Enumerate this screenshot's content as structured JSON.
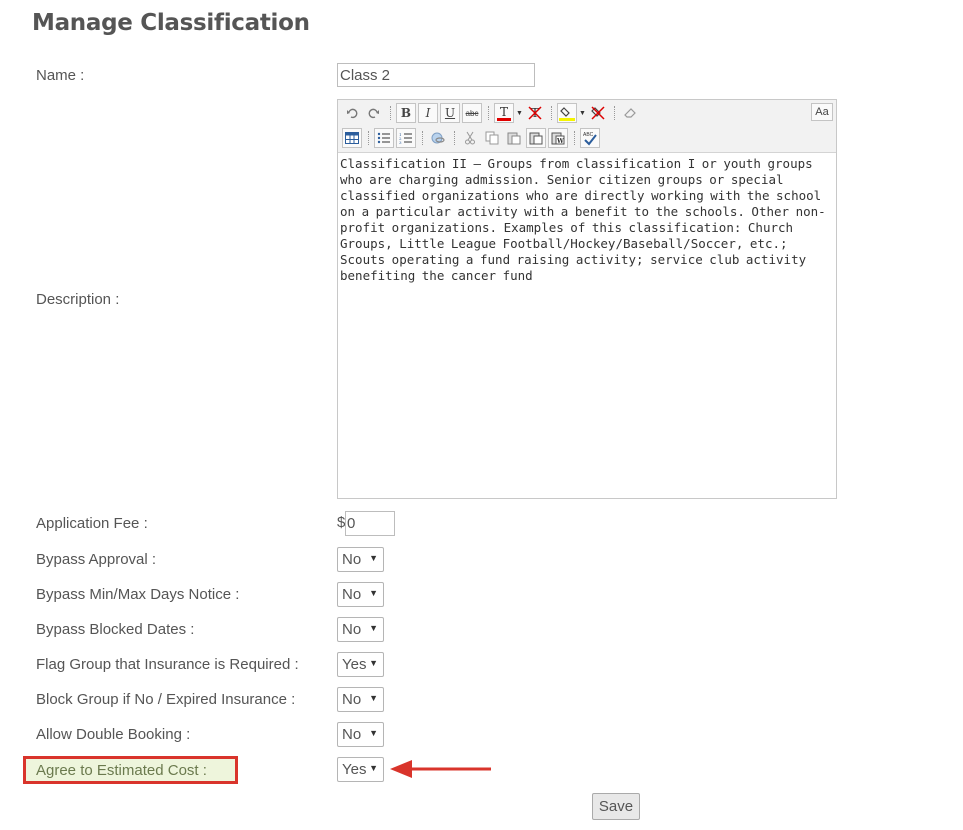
{
  "page": {
    "title": "Manage Classification"
  },
  "name_field": {
    "label": "Name :",
    "value": "Class 2"
  },
  "description": {
    "label": "Description :",
    "text": "Classification II – Groups from classification I or youth groups who are charging admission. Senior citizen groups or special classified organizations who are directly working with the school on a particular activity with a benefit to the schools. Other non-profit organizations. Examples of this classification: Church Groups, Little League Football/Hockey/Baseball/Soccer, etc.; Scouts operating a fund raising activity; service club activity benefiting the cancer fund",
    "toolbar": {
      "font_size_label": "Aa",
      "icons": [
        "undo-icon",
        "redo-icon",
        "bold-icon",
        "italic-icon",
        "underline-icon",
        "strikethrough-icon",
        "font-color-icon",
        "remove-font-color-icon",
        "highlight-color-icon",
        "remove-highlight-icon",
        "eraser-icon",
        "table-icon",
        "bullet-list-icon",
        "numbered-list-icon",
        "link-icon",
        "cut-icon",
        "copy-icon",
        "paste-icon",
        "paste-text-icon",
        "paste-word-icon",
        "spellcheck-icon"
      ],
      "font_color": "#e00000",
      "highlight_color": "#f5f500"
    }
  },
  "application_fee": {
    "label": "Application Fee :",
    "currency": "$",
    "value": "0"
  },
  "fields": [
    {
      "label": "Bypass Approval :",
      "value": "No"
    },
    {
      "label": "Bypass Min/Max Days Notice :",
      "value": "No"
    },
    {
      "label": "Bypass Blocked Dates :",
      "value": "No"
    },
    {
      "label": "Flag Group that Insurance is Required :",
      "value": "Yes"
    },
    {
      "label": "Block Group if No / Expired Insurance :",
      "value": "No"
    },
    {
      "label": "Allow Double Booking :",
      "value": "No"
    },
    {
      "label": "Agree to Estimated Cost :",
      "value": "Yes"
    }
  ],
  "save_label": "Save",
  "colors": {
    "highlight_border": "#d9342b",
    "highlight_fill": "#eef5dc",
    "arrow": "#d9342b"
  }
}
